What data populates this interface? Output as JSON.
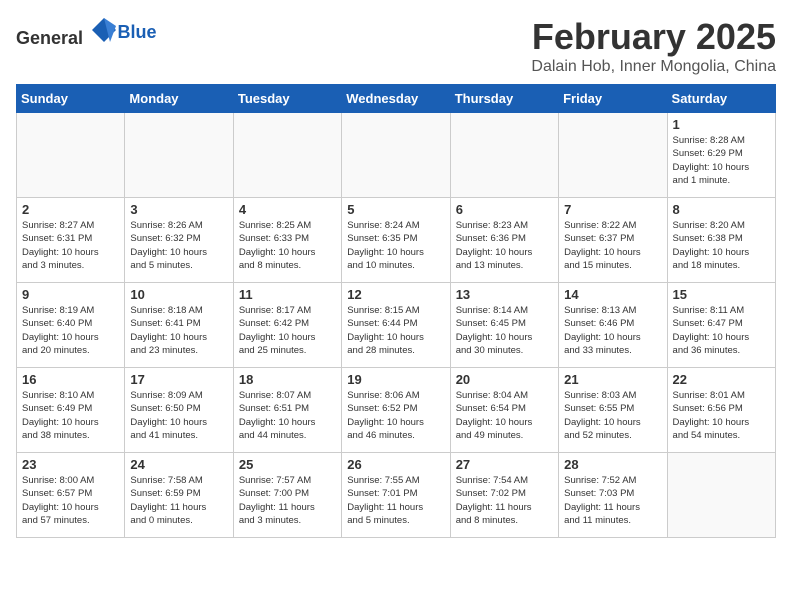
{
  "logo": {
    "general": "General",
    "blue": "Blue"
  },
  "header": {
    "month": "February 2025",
    "location": "Dalain Hob, Inner Mongolia, China"
  },
  "weekdays": [
    "Sunday",
    "Monday",
    "Tuesday",
    "Wednesday",
    "Thursday",
    "Friday",
    "Saturday"
  ],
  "weeks": [
    [
      {
        "day": "",
        "info": ""
      },
      {
        "day": "",
        "info": ""
      },
      {
        "day": "",
        "info": ""
      },
      {
        "day": "",
        "info": ""
      },
      {
        "day": "",
        "info": ""
      },
      {
        "day": "",
        "info": ""
      },
      {
        "day": "1",
        "info": "Sunrise: 8:28 AM\nSunset: 6:29 PM\nDaylight: 10 hours\nand 1 minute."
      }
    ],
    [
      {
        "day": "2",
        "info": "Sunrise: 8:27 AM\nSunset: 6:31 PM\nDaylight: 10 hours\nand 3 minutes."
      },
      {
        "day": "3",
        "info": "Sunrise: 8:26 AM\nSunset: 6:32 PM\nDaylight: 10 hours\nand 5 minutes."
      },
      {
        "day": "4",
        "info": "Sunrise: 8:25 AM\nSunset: 6:33 PM\nDaylight: 10 hours\nand 8 minutes."
      },
      {
        "day": "5",
        "info": "Sunrise: 8:24 AM\nSunset: 6:35 PM\nDaylight: 10 hours\nand 10 minutes."
      },
      {
        "day": "6",
        "info": "Sunrise: 8:23 AM\nSunset: 6:36 PM\nDaylight: 10 hours\nand 13 minutes."
      },
      {
        "day": "7",
        "info": "Sunrise: 8:22 AM\nSunset: 6:37 PM\nDaylight: 10 hours\nand 15 minutes."
      },
      {
        "day": "8",
        "info": "Sunrise: 8:20 AM\nSunset: 6:38 PM\nDaylight: 10 hours\nand 18 minutes."
      }
    ],
    [
      {
        "day": "9",
        "info": "Sunrise: 8:19 AM\nSunset: 6:40 PM\nDaylight: 10 hours\nand 20 minutes."
      },
      {
        "day": "10",
        "info": "Sunrise: 8:18 AM\nSunset: 6:41 PM\nDaylight: 10 hours\nand 23 minutes."
      },
      {
        "day": "11",
        "info": "Sunrise: 8:17 AM\nSunset: 6:42 PM\nDaylight: 10 hours\nand 25 minutes."
      },
      {
        "day": "12",
        "info": "Sunrise: 8:15 AM\nSunset: 6:44 PM\nDaylight: 10 hours\nand 28 minutes."
      },
      {
        "day": "13",
        "info": "Sunrise: 8:14 AM\nSunset: 6:45 PM\nDaylight: 10 hours\nand 30 minutes."
      },
      {
        "day": "14",
        "info": "Sunrise: 8:13 AM\nSunset: 6:46 PM\nDaylight: 10 hours\nand 33 minutes."
      },
      {
        "day": "15",
        "info": "Sunrise: 8:11 AM\nSunset: 6:47 PM\nDaylight: 10 hours\nand 36 minutes."
      }
    ],
    [
      {
        "day": "16",
        "info": "Sunrise: 8:10 AM\nSunset: 6:49 PM\nDaylight: 10 hours\nand 38 minutes."
      },
      {
        "day": "17",
        "info": "Sunrise: 8:09 AM\nSunset: 6:50 PM\nDaylight: 10 hours\nand 41 minutes."
      },
      {
        "day": "18",
        "info": "Sunrise: 8:07 AM\nSunset: 6:51 PM\nDaylight: 10 hours\nand 44 minutes."
      },
      {
        "day": "19",
        "info": "Sunrise: 8:06 AM\nSunset: 6:52 PM\nDaylight: 10 hours\nand 46 minutes."
      },
      {
        "day": "20",
        "info": "Sunrise: 8:04 AM\nSunset: 6:54 PM\nDaylight: 10 hours\nand 49 minutes."
      },
      {
        "day": "21",
        "info": "Sunrise: 8:03 AM\nSunset: 6:55 PM\nDaylight: 10 hours\nand 52 minutes."
      },
      {
        "day": "22",
        "info": "Sunrise: 8:01 AM\nSunset: 6:56 PM\nDaylight: 10 hours\nand 54 minutes."
      }
    ],
    [
      {
        "day": "23",
        "info": "Sunrise: 8:00 AM\nSunset: 6:57 PM\nDaylight: 10 hours\nand 57 minutes."
      },
      {
        "day": "24",
        "info": "Sunrise: 7:58 AM\nSunset: 6:59 PM\nDaylight: 11 hours\nand 0 minutes."
      },
      {
        "day": "25",
        "info": "Sunrise: 7:57 AM\nSunset: 7:00 PM\nDaylight: 11 hours\nand 3 minutes."
      },
      {
        "day": "26",
        "info": "Sunrise: 7:55 AM\nSunset: 7:01 PM\nDaylight: 11 hours\nand 5 minutes."
      },
      {
        "day": "27",
        "info": "Sunrise: 7:54 AM\nSunset: 7:02 PM\nDaylight: 11 hours\nand 8 minutes."
      },
      {
        "day": "28",
        "info": "Sunrise: 7:52 AM\nSunset: 7:03 PM\nDaylight: 11 hours\nand 11 minutes."
      },
      {
        "day": "",
        "info": ""
      }
    ]
  ]
}
